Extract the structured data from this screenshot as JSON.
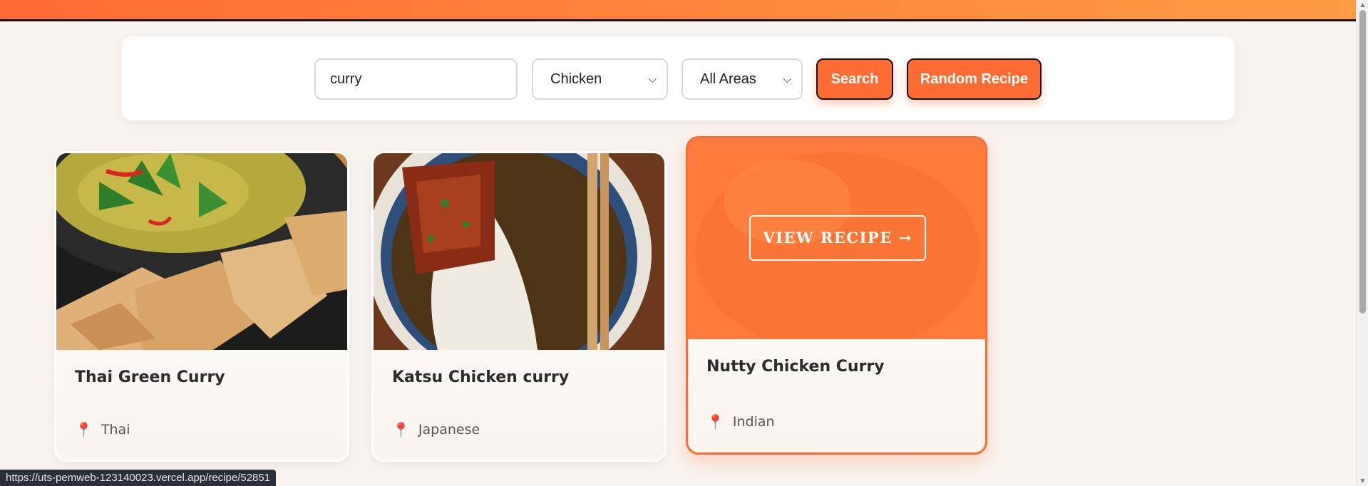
{
  "search": {
    "query": "curry",
    "category_selected": "Chicken",
    "area_selected": "All Areas",
    "search_label": "Search",
    "random_label": "Random Recipe"
  },
  "recipes": [
    {
      "title": "Thai Green Curry",
      "area": "Thai"
    },
    {
      "title": "Katsu Chicken curry",
      "area": "Japanese"
    },
    {
      "title": "Nutty Chicken Curry",
      "area": "Indian",
      "overlay_label": "VIEW RECIPE →"
    }
  ],
  "icons": {
    "location": "location-pin-icon",
    "select_arrow": "chevron-down-icon"
  },
  "colors": {
    "accent": "#ff6b35",
    "background": "#f9f3ef",
    "pin": "#e2306c"
  },
  "status_bar": {
    "url": "https://uts-pemweb-123140023.vercel.app/recipe/52851"
  }
}
